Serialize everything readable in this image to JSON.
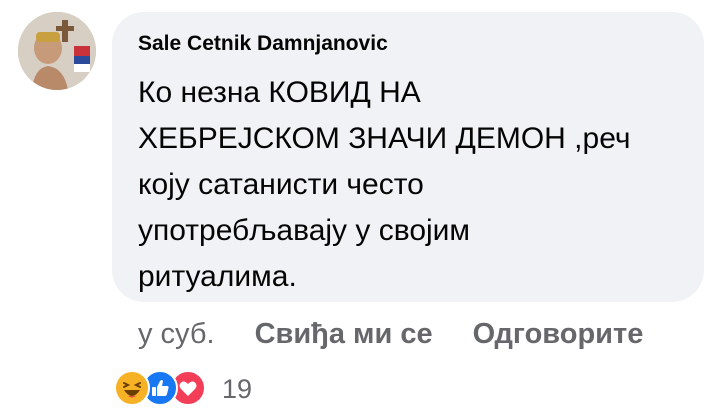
{
  "comment": {
    "author": "Sale Cetnik Damnjanovic",
    "text": "Ко незна КОВИД НА\nХЕБРЕЈСКОМ ЗНАЧИ ДЕМОН ,реч\nкоју сатанисти често\nупотребљавају у својим\nритуалима.",
    "time": "у суб.",
    "like_label": "Свиђа ми се",
    "reply_label": "Одговорите",
    "reaction_count": "19",
    "reactions": [
      "haha-icon",
      "like-icon",
      "love-icon"
    ]
  },
  "colors": {
    "bubble": "#f0f2f5",
    "meta_text": "#65676b",
    "like_blue": "#1877f2",
    "love_red": "#f33e58",
    "haha_yellow": "#f7b125"
  }
}
